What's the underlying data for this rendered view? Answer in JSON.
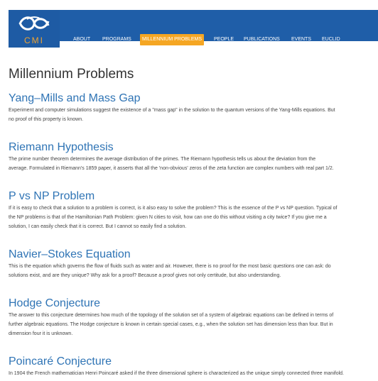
{
  "logo": {
    "text": "CMI"
  },
  "nav": {
    "items": [
      {
        "label": "ABOUT",
        "active": false
      },
      {
        "label": "PROGRAMS",
        "active": false
      },
      {
        "label": "MILLENNIUM PROBLEMS",
        "active": true
      },
      {
        "label": "PEOPLE",
        "active": false
      },
      {
        "label": "PUBLICATIONS",
        "active": false
      },
      {
        "label": "EVENTS",
        "active": false
      },
      {
        "label": "EUCLID",
        "active": false
      }
    ]
  },
  "page": {
    "title": "Millennium Problems"
  },
  "colors": {
    "nav_bar": "#1f5ea8",
    "active_nav": "#f5a623",
    "link": "#2f74b5",
    "logo_accent": "#f0a330"
  },
  "problems": [
    {
      "title": "Yang–Mills and Mass Gap",
      "lines": [
        "Experiment and computer simulations suggest the existence of a \"mass gap\" in the solution to the quantum versions of the Yang-Mills equations. But",
        "no proof of this property is known."
      ]
    },
    {
      "title": "Riemann Hypothesis",
      "lines": [
        "The prime number theorem determines the average distribution of the primes. The Riemann hypothesis tells us about the deviation from the",
        "average. Formulated in Riemann's 1859 paper, it asserts that all the 'non-obvious' zeros of the zeta function are complex numbers with real part 1/2."
      ]
    },
    {
      "title": "P vs NP Problem",
      "lines": [
        "If it is easy to check that a solution to a problem is correct, is it also easy to solve the problem? This is the essence of the P vs NP question. Typical of",
        "the NP problems is that of the Hamiltonian Path Problem: given N cities to visit, how can one do this without visiting a city twice? If you give me a",
        "solution, I can easily check that it is correct. But I cannot so easily find a solution."
      ]
    },
    {
      "title": "Navier–Stokes Equation",
      "lines": [
        "This is the equation which governs the flow of fluids such as water and air. However, there is no proof for the most basic questions one can ask: do",
        "solutions exist, and are they unique? Why ask for a proof? Because a proof gives not only certitude, but also understanding."
      ]
    },
    {
      "title": "Hodge Conjecture",
      "lines": [
        "The answer to this conjecture determines how much of the topology of the solution set of a system of algebraic equations can be defined in terms of",
        "further algebraic equations. The Hodge conjecture is known in certain special cases, e.g., when the solution set has dimension less than four. But in",
        "dimension four it is unknown."
      ]
    },
    {
      "title": "Poincaré Conjecture",
      "lines": [
        "In 1904 the French mathematician Henri Poincaré asked if the three dimensional sphere is characterized as the unique simply connected three manifold."
      ]
    }
  ]
}
